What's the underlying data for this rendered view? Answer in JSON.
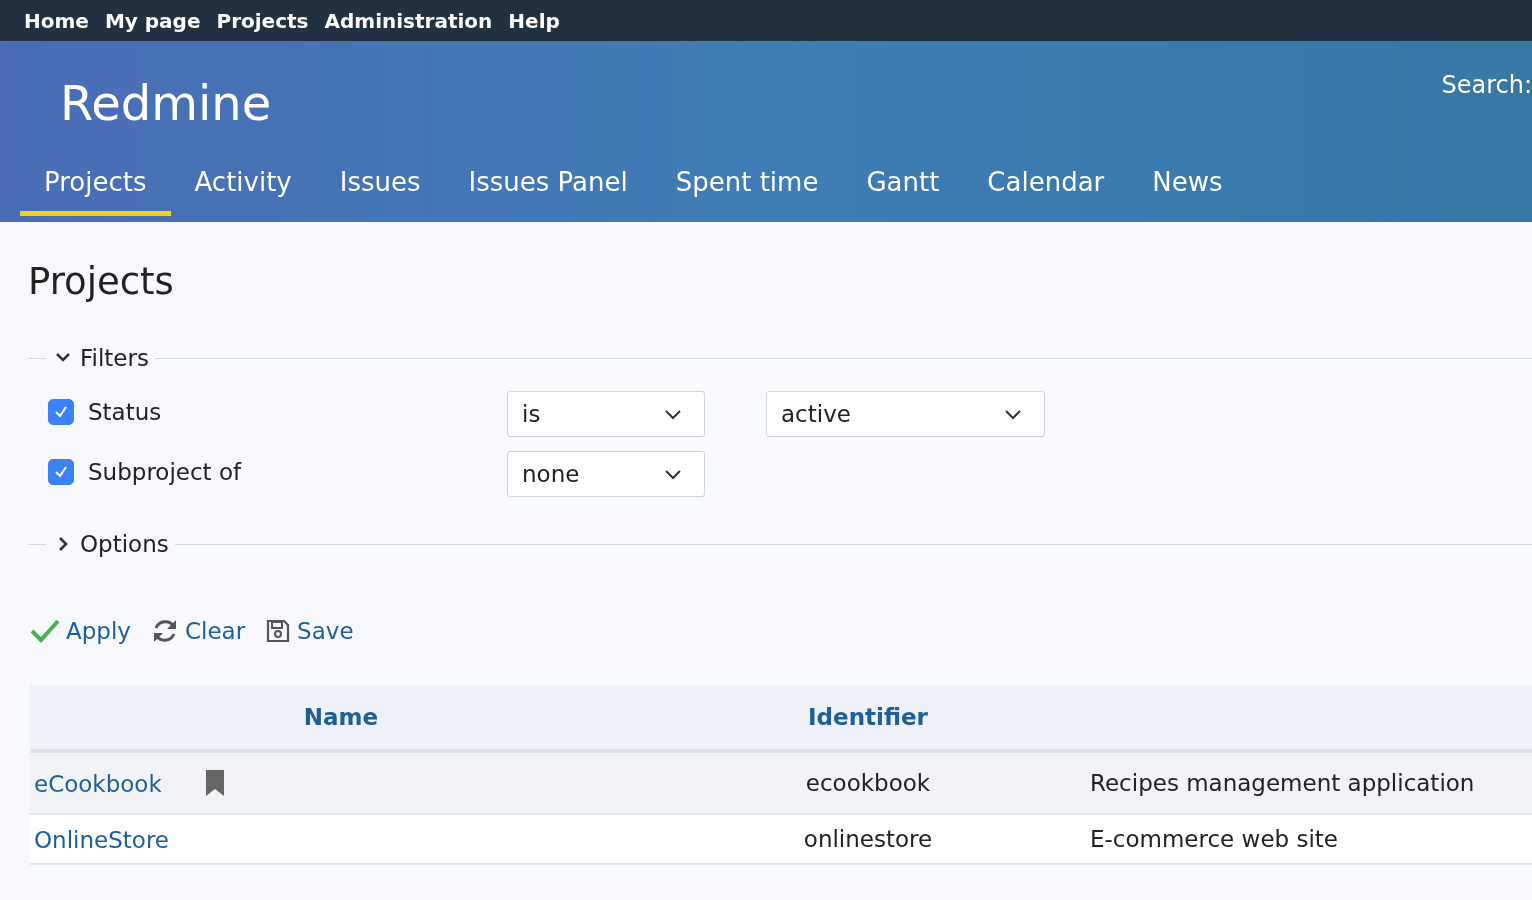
{
  "top_menu": [
    {
      "label": "Home"
    },
    {
      "label": "My page"
    },
    {
      "label": "Projects"
    },
    {
      "label": "Administration"
    },
    {
      "label": "Help"
    }
  ],
  "header": {
    "title": "Redmine",
    "search_label": "Search:"
  },
  "main_menu": [
    {
      "label": "Projects",
      "selected": true
    },
    {
      "label": "Activity",
      "selected": false
    },
    {
      "label": "Issues",
      "selected": false
    },
    {
      "label": "Issues Panel",
      "selected": false
    },
    {
      "label": "Spent time",
      "selected": false
    },
    {
      "label": "Gantt",
      "selected": false
    },
    {
      "label": "Calendar",
      "selected": false
    },
    {
      "label": "News",
      "selected": false
    }
  ],
  "page_title": "Projects",
  "filters": {
    "legend": "Filters",
    "expanded": true,
    "rows": [
      {
        "label": "Status",
        "checked": true,
        "operator": "is",
        "value": "active"
      },
      {
        "label": "Subproject of",
        "checked": true,
        "operator": "none"
      }
    ]
  },
  "options": {
    "legend": "Options",
    "expanded": false
  },
  "actions": [
    {
      "kind": "apply",
      "label": "Apply"
    },
    {
      "kind": "clear",
      "label": "Clear"
    },
    {
      "kind": "save",
      "label": "Save"
    }
  ],
  "table": {
    "columns": [
      "Name",
      "Identifier"
    ],
    "rows": [
      {
        "name": "eCookbook",
        "bookmarked": true,
        "identifier": "ecookbook",
        "column_3": "Recipes management application"
      },
      {
        "name": "OnlineStore",
        "bookmarked": false,
        "identifier": "onlinestore",
        "column_3": "E-commerce web site"
      }
    ]
  }
}
